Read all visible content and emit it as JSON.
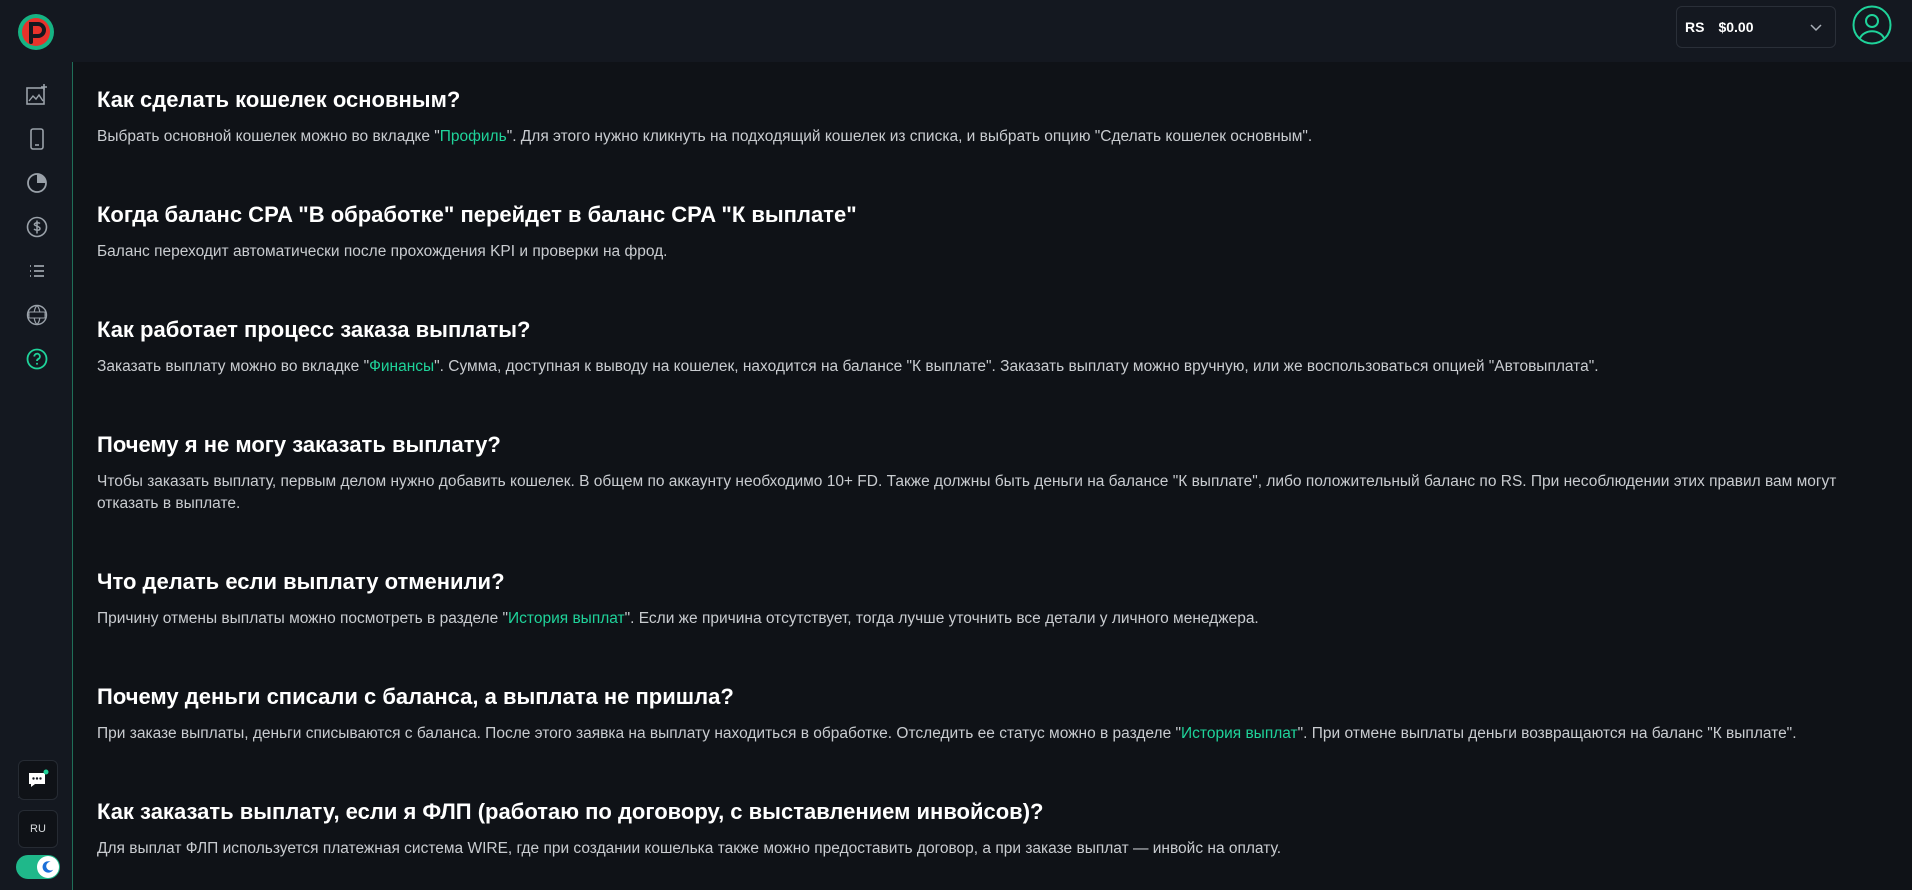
{
  "header": {
    "logo_letter": "P",
    "balance_currency": "RS",
    "balance_amount": "$0.00"
  },
  "sidebar": {
    "icons": [
      "add-image-icon",
      "phone-icon",
      "pie-chart-icon",
      "dollar-icon",
      "list-icon",
      "news-icon",
      "help-icon"
    ],
    "active_icon": "help-icon",
    "lang": "RU",
    "accent_color": "#1fd39a"
  },
  "faq": [
    {
      "q": "Как сделать кошелек основным?",
      "a_before": "Выбрать основной кошелек можно во вкладке \"",
      "a_link": "Профиль",
      "a_after": "\". Для этого нужно кликнуть на подходящий кошелек из списка, и выбрать опцию \"Сделать кошелек основным\"."
    },
    {
      "q": "Когда баланс CPA \"В обработке\" перейдет в баланс CPA \"К выплате\"",
      "a_before": "Баланс переходит автоматически после прохождения KPI и проверки на фрод.",
      "a_link": "",
      "a_after": ""
    },
    {
      "q": "Как работает процесс заказа выплаты?",
      "a_before": "Заказать выплату можно во вкладке \"",
      "a_link": "Финансы",
      "a_after": "\". Сумма, доступная к выводу на кошелек, находится на балансе \"К выплате\". Заказать выплату можно вручную, или же воспользоваться опцией \"Автовыплата\"."
    },
    {
      "q": "Почему я не могу заказать выплату?",
      "a_before": "Чтобы заказать выплату, первым делом нужно добавить кошелек. В общем по аккаунту необходимо 10+ FD. Также должны быть деньги на балансе \"К выплате\", либо положительный баланс по RS. При несоблюдении этих правил вам могут отказать в выплате.",
      "a_link": "",
      "a_after": ""
    },
    {
      "q": "Что делать если выплату отменили?",
      "a_before": "Причину отмены выплаты можно посмотреть в разделе \"",
      "a_link": "История выплат",
      "a_after": "\". Если же причина отсутствует, тогда лучше уточнить все детали у личного менеджера."
    },
    {
      "q": "Почему деньги списали с баланса, а выплата не пришла?",
      "a_before": "При заказе выплаты, деньги списываются с баланса. После этого заявка на выплату находиться в обработке. Отследить ее статус можно в разделе \"",
      "a_link": "История выплат",
      "a_after": "\". При отмене выплаты деньги возвращаются на баланс \"К выплате\"."
    },
    {
      "q": "Как заказать выплату, если я ФЛП (работаю по договору, с выставлением инвойсов)?",
      "a_before": "Для выплат ФЛП используется платежная система WIRE, где при создании кошелька также можно предоставить договор, а при заказе выплат — инвойс на оплату.",
      "a_link": "",
      "a_after": ""
    }
  ]
}
